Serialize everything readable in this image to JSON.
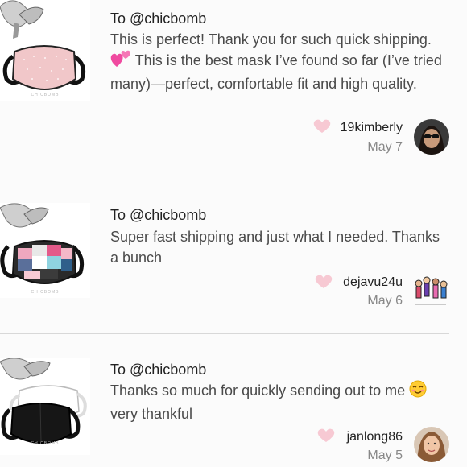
{
  "reviews": [
    {
      "to": "To @chicbomb",
      "text_before_emoji": "This is perfect! Thank you for such quick shipping.",
      "emoji": "two-hearts-emoji",
      "text_after_emoji": "This is the best mask I’ve found so far (I’ve tried many)—perfect, comfortable fit and high quality.",
      "reviewer": "19kimberly",
      "date": "May 7",
      "thumb_brand": "CHICBOMB"
    },
    {
      "to": "To @chicbomb",
      "text": "Super fast shipping and just what I needed. Thanks a bunch",
      "reviewer": "dejavu24u",
      "date": "May 6",
      "thumb_brand": "CHICBOMB"
    },
    {
      "to": "To @chicbomb",
      "text_before_emoji": "Thanks so much for quickly sending out to me",
      "emoji": "smiling-blush-emoji",
      "text_after_emoji": "very thankful",
      "reviewer": "janlong86",
      "date": "May 5",
      "thumb_brand": "CHICBOMB"
    }
  ],
  "colors": {
    "background": "#fbfbfb",
    "heart": "#f7c9d3",
    "text": "#4a4a4a",
    "muted": "#888888",
    "divider": "#d8d8d8"
  }
}
